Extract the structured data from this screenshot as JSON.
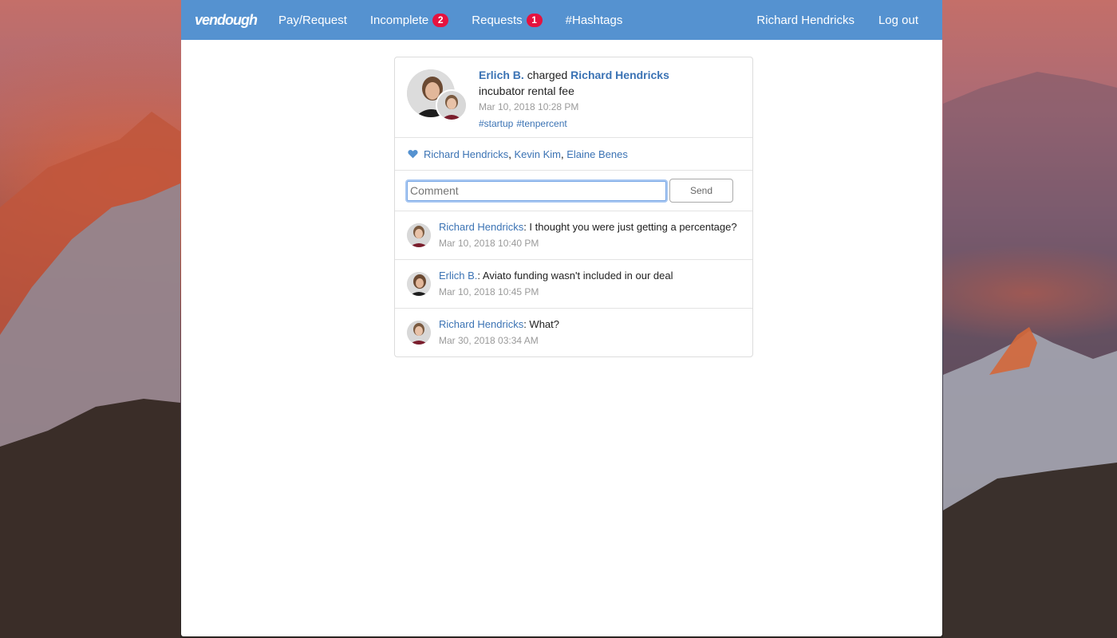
{
  "nav": {
    "brand": "vendough",
    "links": [
      {
        "label": "Pay/Request"
      },
      {
        "label": "Incomplete",
        "badge": "2"
      },
      {
        "label": "Requests",
        "badge": "1"
      },
      {
        "label": "#Hashtags"
      }
    ],
    "user": "Richard Hendricks",
    "logout": "Log out"
  },
  "transaction": {
    "actor": "Erlich B.",
    "action": "charged",
    "target": "Richard Hendricks",
    "description": "incubator rental fee",
    "time": "Mar 10, 2018 10:28 PM",
    "tags": [
      "#startup",
      "#tenpercent"
    ]
  },
  "likes": {
    "names": [
      "Richard Hendricks",
      "Kevin Kim",
      "Elaine Benes"
    ],
    "separator": ","
  },
  "comment_form": {
    "placeholder": "Comment",
    "send_label": "Send"
  },
  "comments": [
    {
      "author": "Richard Hendricks",
      "text": ": I thought you were just getting a percentage?",
      "time": "Mar 10, 2018 10:40 PM"
    },
    {
      "author": "Erlich B.",
      "text": ": Aviato funding wasn't included in our deal",
      "time": "Mar 10, 2018 10:45 PM"
    },
    {
      "author": "Richard Hendricks",
      "text": ": What?",
      "time": "Mar 30, 2018 03:34 AM"
    }
  ],
  "colors": {
    "navbar": "#5592d0",
    "link": "#3b73b4",
    "badge": "#e5123f",
    "heart": "#5592d0"
  }
}
